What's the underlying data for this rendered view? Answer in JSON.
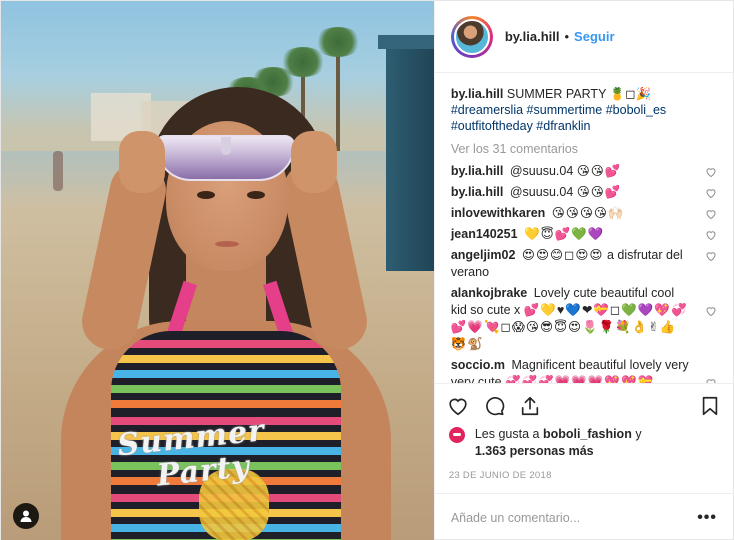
{
  "post": {
    "username": "by.lia.hill",
    "follow_label": "Seguir",
    "separator": "•",
    "caption": {
      "username": "by.lia.hill",
      "text": "SUMMER PARTY 🍍◻🎉",
      "hashtags": "#dreamerslia #summertime #boboli_es #outfitoftheday #dfranklin"
    },
    "view_comments": "Ver los 31 comentarios",
    "comments": [
      {
        "user": "by.lia.hill",
        "text": "@suusu.04",
        "emoji": "😘😘💕"
      },
      {
        "user": "by.lia.hill",
        "text": "@suusu.04",
        "emoji": "😘😘💕"
      },
      {
        "user": "inlovewithkaren",
        "text": "",
        "emoji": "😘😘😘😘🙌🏻"
      },
      {
        "user": "jean140251",
        "text": "",
        "emoji": "💛😇💕💚💜"
      },
      {
        "user": "angeljim02",
        "text": "a disfrutar del verano",
        "emoji": "😍😍😊◻😍😍"
      },
      {
        "user": "alankojbrake",
        "text": "Lovely cute beautiful cool kid so cute x",
        "emoji": "💕💛♥💙❤💝◻💚💜💖💞💕💗💘◻😱😘😎😇😍🌷🌹💐👌✌👍🐯🐒"
      },
      {
        "user": "soccio.m",
        "text": "Magnificent beautiful lovely very very cute",
        "emoji": "💞💞💞💗💗💗💖💖💝"
      }
    ],
    "likes": {
      "prefix": "Les gusta a",
      "user": "boboli_fashion",
      "connector": "y",
      "count": "1.363 personas más"
    },
    "date": "23 DE JUNIO DE 2018",
    "comment_input": {
      "placeholder": "Añade un comentario..."
    },
    "more_label": "•••",
    "photo_print": [
      "Summer",
      "Party"
    ]
  }
}
